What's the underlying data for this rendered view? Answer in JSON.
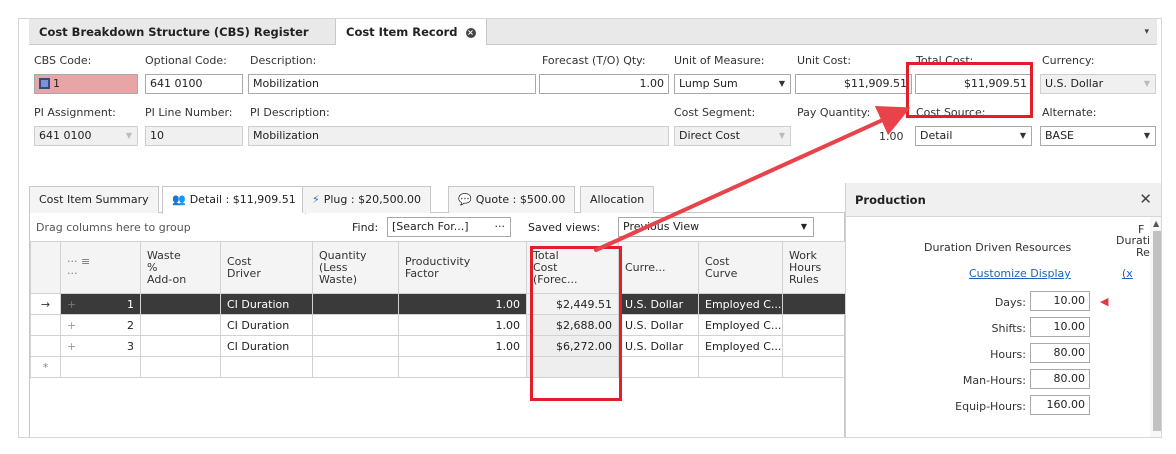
{
  "tabs": {
    "cbs_register": "Cost Breakdown Structure (CBS) Register",
    "cost_item_record": "Cost Item Record",
    "close_glyph": "×",
    "menu_glyph": "▾"
  },
  "header": {
    "cbs_code_label": "CBS Code:",
    "cbs_code_value": "1",
    "optional_code_label": "Optional Code:",
    "optional_code_value": "641 0100",
    "description_label": "Description:",
    "description_value": "Mobilization",
    "forecast_qty_label": "Forecast (T/O) Qty:",
    "forecast_qty_value": "1.00",
    "uom_label": "Unit of Measure:",
    "uom_value": "Lump Sum",
    "unit_cost_label": "Unit Cost:",
    "unit_cost_value": "$11,909.51",
    "total_cost_label": "Total Cost:",
    "total_cost_value": "$11,909.51",
    "currency_label": "Currency:",
    "currency_value": "U.S. Dollar",
    "pi_assignment_label": "PI Assignment:",
    "pi_assignment_value": "641 0100",
    "pi_line_number_label": "PI Line Number:",
    "pi_line_number_value": "10",
    "pi_description_label": "PI Description:",
    "pi_description_value": "Mobilization",
    "cost_segment_label": "Cost Segment:",
    "cost_segment_value": "Direct Cost",
    "pay_quantity_label": "Pay Quantity:",
    "pay_quantity_value": "1.00",
    "cost_source_label": "Cost Source:",
    "cost_source_value": "Detail",
    "alternate_label": "Alternate:",
    "alternate_value": "BASE"
  },
  "subtabs": [
    {
      "label": "Cost Item Summary"
    },
    {
      "label": "Detail : $11,909.51"
    },
    {
      "label": "Plug : $20,500.00"
    },
    {
      "label": "Quote : $500.00"
    },
    {
      "label": "Allocation"
    }
  ],
  "grid": {
    "group_hint": "Drag columns here to group",
    "find_label": "Find:",
    "find_placeholder": "[Search For...]",
    "find_dots": "···",
    "saved_views_label": "Saved views:",
    "saved_views_value": "Previous View",
    "columns": {
      "menu": "··· ≡\n···",
      "waste": "Waste\n%\nAdd-on",
      "cost_driver": "Cost\nDriver",
      "quantity": "Quantity\n(Less\nWaste)",
      "productivity": "Productivity\nFactor",
      "total_cost": "Total\nCost\n(Forec...",
      "currency": "Curre...",
      "cost_curve": "Cost\nCurve",
      "work_hours": "Work\nHours\nRules"
    },
    "rows": [
      {
        "indicator": "→",
        "num": "1",
        "driver": "CI Duration",
        "productivity": "1.00",
        "total": "$2,449.51",
        "currency": "U.S. Dollar",
        "curve": "Employed C..."
      },
      {
        "indicator": "",
        "num": "2",
        "driver": "CI Duration",
        "productivity": "1.00",
        "total": "$2,688.00",
        "currency": "U.S. Dollar",
        "curve": "Employed C..."
      },
      {
        "indicator": "",
        "num": "3",
        "driver": "CI Duration",
        "productivity": "1.00",
        "total": "$6,272.00",
        "currency": "U.S. Dollar",
        "curve": "Employed C..."
      }
    ],
    "new_row_indicator": "*",
    "plus_glyph": "+"
  },
  "production": {
    "title": "Production",
    "close_glyph": "✕",
    "section_title": "Duration Driven Resources",
    "customize_link": "Customize Display",
    "clip_top": "F",
    "clip_duratio": "Duratio",
    "clip_re": "Re",
    "clip_x": "(x",
    "rows": [
      {
        "label": "Days:",
        "value": "10.00"
      },
      {
        "label": "Shifts:",
        "value": "10.00"
      },
      {
        "label": "Hours:",
        "value": "80.00"
      },
      {
        "label": "Man-Hours:",
        "value": "80.00"
      },
      {
        "label": "Equip-Hours:",
        "value": "160.00"
      }
    ]
  },
  "colors": {
    "annotation_red": "#e21f26",
    "selected_row": "#3a3a3a",
    "link_blue": "#1f5fbf",
    "cbs_code_highlight": "#e8a5a5"
  }
}
